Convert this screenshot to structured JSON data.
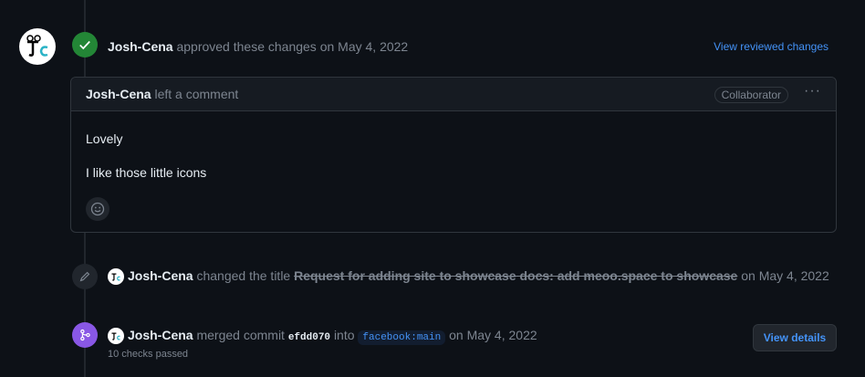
{
  "review": {
    "author": "Josh-Cena",
    "action": "approved these changes on",
    "date": "May 4, 2022",
    "link": "View reviewed changes"
  },
  "comment": {
    "author": "Josh-Cena",
    "action": "left a comment",
    "badge": "Collaborator",
    "menu": "···",
    "lines": [
      "Lovely",
      "I like those little icons"
    ]
  },
  "title_change": {
    "author": "Josh-Cena",
    "action": "changed the title",
    "old_title": "Request for adding site to showcase docs: add meoo.space to showcase",
    "date_prefix": "on",
    "date": "May 4, 2022"
  },
  "merge": {
    "author": "Josh-Cena",
    "action": "merged commit",
    "commit": "efdd070",
    "into": "into",
    "branch": "facebook:main",
    "date_prefix": "on",
    "date": "May 4, 2022",
    "checks": "10 checks passed",
    "button": "View details"
  },
  "avatar_text": "JC",
  "colors": {
    "background": "#0d1117",
    "approved": "#238636",
    "merged": "#8957e5",
    "link": "#4493f8"
  }
}
